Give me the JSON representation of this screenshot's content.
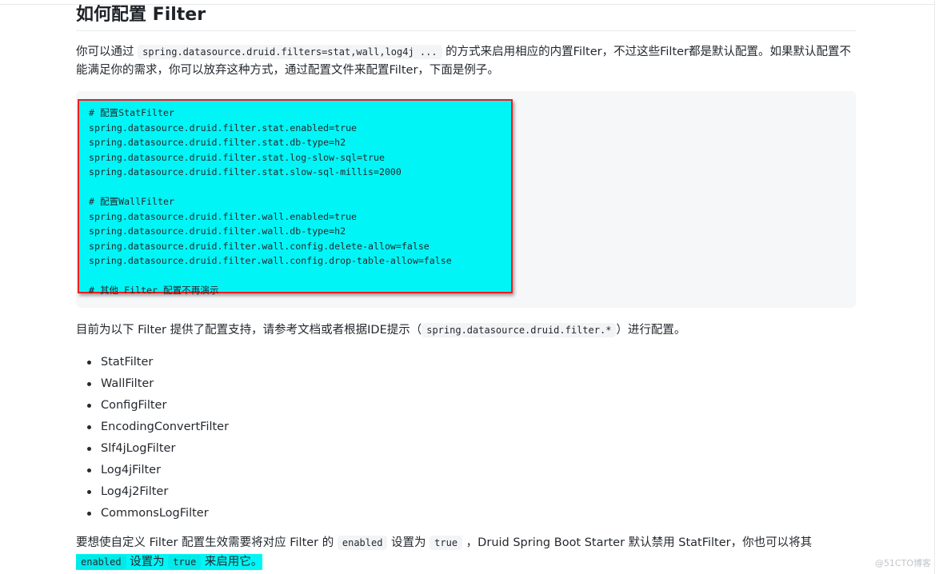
{
  "heading": "如何配置 Filter",
  "intro": {
    "text_before": "你可以通过 ",
    "code": "spring.datasource.druid.filters=stat,wall,log4j ...",
    "text_after": " 的方式来启用相应的内置Filter，不过这些Filter都是默认配置。如果默认配置不能满足你的需求，你可以放弃这种方式，通过配置文件来配置Filter，下面是例子。"
  },
  "code_block": {
    "lines": [
      "# 配置StatFilter",
      "spring.datasource.druid.filter.stat.enabled=true",
      "spring.datasource.druid.filter.stat.db-type=h2",
      "spring.datasource.druid.filter.stat.log-slow-sql=true",
      "spring.datasource.druid.filter.stat.slow-sql-millis=2000",
      "",
      "# 配置WallFilter",
      "spring.datasource.druid.filter.wall.enabled=true",
      "spring.datasource.druid.filter.wall.db-type=h2",
      "spring.datasource.druid.filter.wall.config.delete-allow=false",
      "spring.datasource.druid.filter.wall.config.drop-table-allow=false",
      "",
      "# 其他 Filter 配置不再演示"
    ],
    "highlight_color": "#00f6f6",
    "border_color": "#ee1c1c"
  },
  "support": {
    "text_before": "目前为以下 Filter 提供了配置支持，请参考文档或者根据IDE提示（",
    "code": "spring.datasource.druid.filter.*",
    "text_after": "）进行配置。"
  },
  "filters": [
    "StatFilter",
    "WallFilter",
    "ConfigFilter",
    "EncodingConvertFilter",
    "Slf4jLogFilter",
    "Log4jFilter",
    "Log4j2Filter",
    "CommonsLogFilter"
  ],
  "custom": {
    "t1": "要想使自定义 Filter 配置生效需要将对应 Filter 的 ",
    "c1": "enabled",
    "t2": " 设置为 ",
    "c2": "true",
    "t3": " ，Druid Spring Boot Starter 默认禁用 StatFilter，你也可以将其",
    "c3": "enabled",
    "t4": " 设置为 ",
    "c4": "true",
    "t5": " 来启用它。"
  },
  "watermark": "@51CTO博客"
}
